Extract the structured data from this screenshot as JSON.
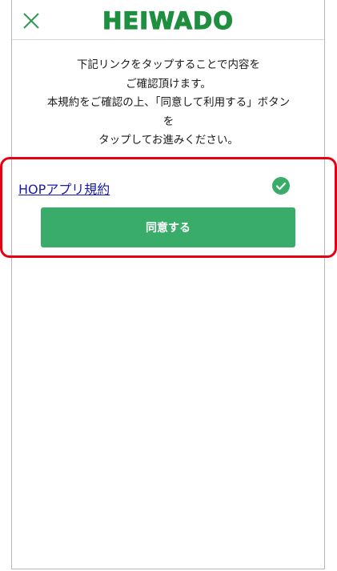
{
  "header": {
    "logo_text": "HEIWADO"
  },
  "instructions": {
    "lines": [
      "下記リンクをタップすることで内容を",
      "ご確認頂けます。",
      "本規約をご確認の上、「同意して利用する」ボタン",
      "を",
      "タップしてお進みください。"
    ]
  },
  "terms": {
    "link_label": "HOPアプリ規約",
    "status": "confirmed"
  },
  "actions": {
    "agree_label": "同意する"
  },
  "colors": {
    "brand_green": "#1e8f3e",
    "button_green": "#3aac6a",
    "highlight_red": "#e60012",
    "link_blue": "#1a1aa6"
  }
}
